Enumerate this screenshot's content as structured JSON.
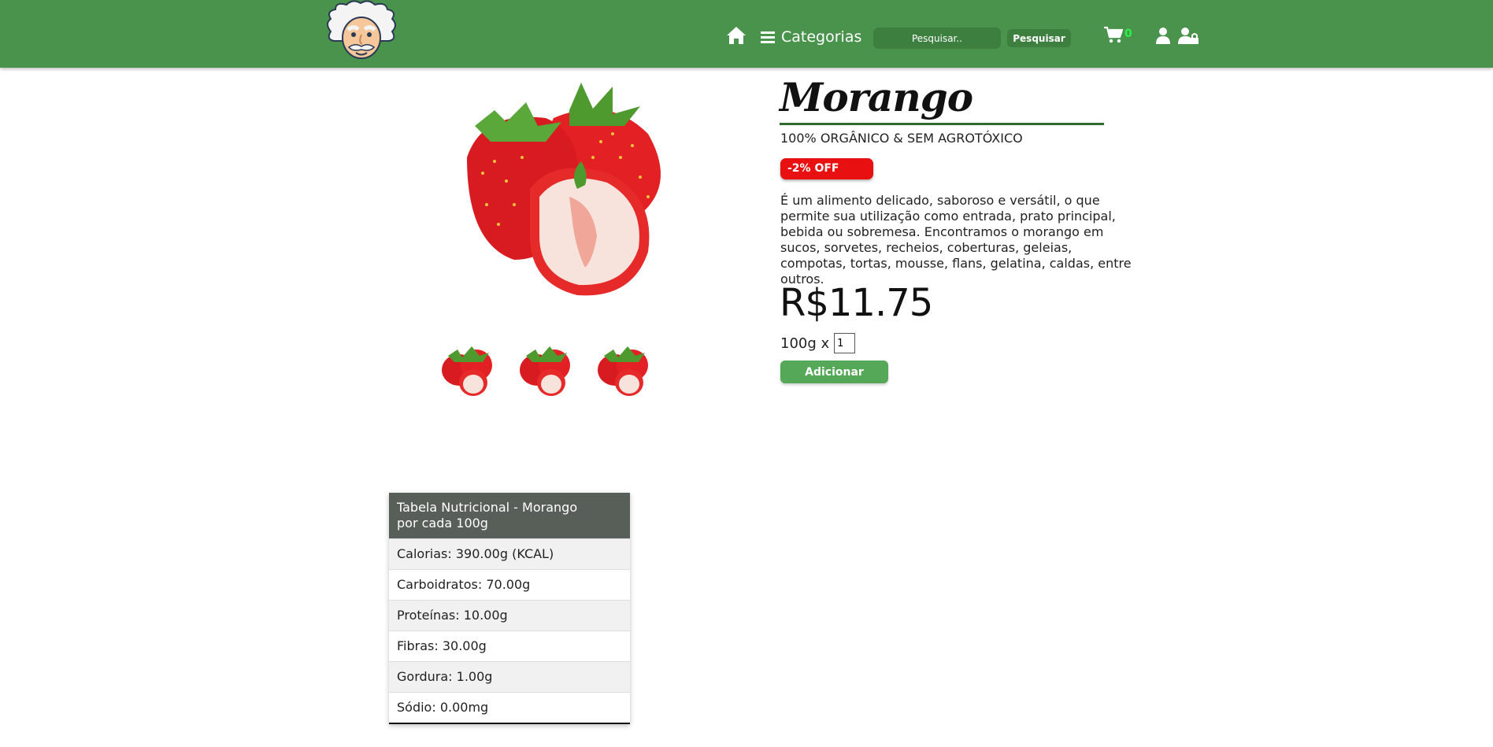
{
  "header": {
    "home_icon": "home-icon",
    "categories_label": "Categorias",
    "search_placeholder": "Pesquisar..",
    "search_button": "Pesquisar",
    "cart_count": "0",
    "colors": {
      "bar": "#4a934c",
      "accent": "#3c7f3e",
      "cart_count": "#2cf34a"
    }
  },
  "product": {
    "name": "Morango",
    "subtitle": "100% ORGÂNICO & SEM AGROTÓXICO",
    "discount": "-2% OFF",
    "description": "É um alimento delicado, saboroso e versátil, o que permite sua utilização como entrada, prato principal, bebida ou sobremesa. Encontramos o morango em sucos, sorvetes, recheios, coberturas, geleias, compotas, tortas, mousse, flans, gelatina, caldas, entre outros.",
    "price": "R$11.75",
    "unit": "100g x",
    "quantity": "1",
    "add_button": "Adicionar",
    "colors": {
      "discount": "#e81010",
      "add_button": "#55a857"
    }
  },
  "nutrition": {
    "title_line1": "Tabela Nutricional - Morango",
    "title_line2": "por cada 100g",
    "rows": [
      "Calorias: 390.00g (KCAL)",
      "Carboidratos: 70.00g",
      "Proteínas: 10.00g",
      "Fibras: 30.00g",
      "Gordura: 1.00g",
      "Sódio: 0.00mg"
    ]
  }
}
